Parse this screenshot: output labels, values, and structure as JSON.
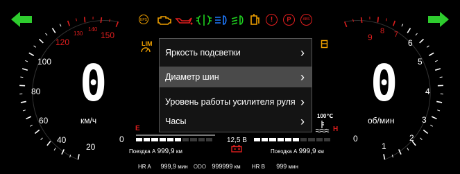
{
  "nav": {
    "left_arrow_icon": "arrow-left-icon",
    "right_arrow_icon": "arrow-right-icon",
    "color": "#2ecc2e"
  },
  "warning_icons": [
    {
      "name": "eps-icon",
      "label": "EPS",
      "color": "#f0a000"
    },
    {
      "name": "engine-icon",
      "color": "#f0a000"
    },
    {
      "name": "oil-icon",
      "color": "#e01e1e"
    },
    {
      "name": "fog-light-icon",
      "color": "#1fd11f"
    },
    {
      "name": "high-beam-icon",
      "color": "#1f7bff"
    },
    {
      "name": "low-beam-icon",
      "color": "#1fd11f"
    },
    {
      "name": "fuel-filter-icon",
      "color": "#f0a000"
    },
    {
      "name": "brake-warning-icon",
      "label": "!",
      "color": "#e01e1e"
    },
    {
      "name": "parking-brake-icon",
      "label": "P",
      "color": "#e01e1e"
    },
    {
      "name": "abs-icon",
      "label": "ABS",
      "color": "#e01e1e"
    }
  ],
  "speedometer": {
    "ticks": [
      "20",
      "40",
      "60",
      "80",
      "100",
      "120",
      "130",
      "140",
      "150"
    ],
    "unit": "км/ч",
    "value_glyph": "0",
    "limiter_label": "LIM"
  },
  "tachometer": {
    "ticks": [
      "1",
      "2",
      "3",
      "4",
      "5",
      "6",
      "7",
      "8",
      "9"
    ],
    "unit": "об/мин",
    "value_glyph": "0",
    "zero_labels": [
      "0",
      "0"
    ]
  },
  "menu": {
    "items": [
      {
        "label": "Яркость подсветки",
        "selected": false
      },
      {
        "label": "Диаметр шин",
        "selected": true
      },
      {
        "label": "Уровень работы усилителя руля",
        "selected": false
      },
      {
        "label": "Часы",
        "selected": false
      }
    ]
  },
  "fuel": {
    "empty_label": "E",
    "level_fraction": 0.6
  },
  "coolant": {
    "hot_label": "H",
    "temp_label": "100℃",
    "level_fraction": 0.6
  },
  "battery": {
    "voltage": "12,5 В"
  },
  "trip_a_left": {
    "label": "Поездка А",
    "value": "999,9",
    "unit": "км"
  },
  "trip_a_right": {
    "label": "Поездка А",
    "value": "999,9",
    "unit": "км"
  },
  "bottom": {
    "hr_a_label": "HR A",
    "hr_a_value": "999,9",
    "hr_a_unit": "мин",
    "odo_label": "ODO",
    "odo_value": "999999",
    "odo_unit": "км",
    "hr_b_label": "HR B",
    "hr_b_value": "999",
    "hr_b_unit": "мин"
  }
}
